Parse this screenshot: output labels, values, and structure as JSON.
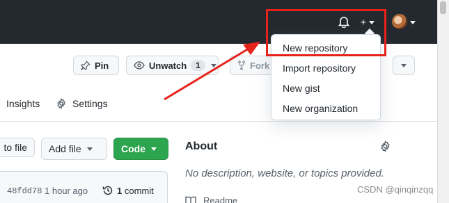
{
  "header": {
    "bell_icon": "bell-icon",
    "create_icon": "plus-icon",
    "avatar_icon": "avatar"
  },
  "repo_actions": {
    "pin_label": "Pin",
    "unwatch_label": "Unwatch",
    "watch_count": "1",
    "fork_label": "Fork"
  },
  "tabs": {
    "insights_label": "Insights",
    "settings_label": "Settings"
  },
  "file_actions": {
    "go_to_file_label": "to file",
    "add_file_label": "Add file",
    "code_label": "Code"
  },
  "commit": {
    "sha": "48fdd78",
    "time_ago": "1 hour ago",
    "count": "1",
    "count_label": "commit"
  },
  "about": {
    "title": "About",
    "description": "No description, website, or topics provided.",
    "readme_label": "Readme"
  },
  "create_menu": {
    "items": [
      {
        "label": "New repository"
      },
      {
        "label": "Import repository"
      },
      {
        "label": "New gist"
      },
      {
        "label": "New organization"
      }
    ]
  },
  "annotation": {
    "highlight_color": "#e5231b"
  },
  "watermark": "CSDN @qinqinzqq"
}
